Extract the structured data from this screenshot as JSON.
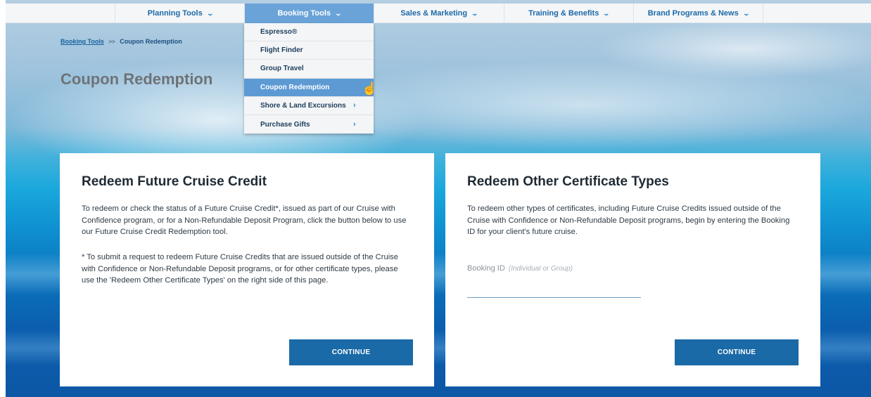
{
  "nav": {
    "items": [
      {
        "label": "Planning Tools",
        "chevron": "⌄"
      },
      {
        "label": "Booking Tools",
        "chevron": "⌄"
      },
      {
        "label": "Sales & Marketing",
        "chevron": "⌄"
      },
      {
        "label": "Training & Benefits",
        "chevron": "⌄"
      },
      {
        "label": "Brand Programs & News",
        "chevron": "⌄"
      }
    ],
    "active": "Booking Tools"
  },
  "dropdown": {
    "items": [
      {
        "label": "Espresso®"
      },
      {
        "label": "Flight Finder"
      },
      {
        "label": "Group Travel"
      },
      {
        "label": "Coupon Redemption"
      },
      {
        "label": "Shore & Land Excursions",
        "arrow": "›"
      },
      {
        "label": "Purchase Gifts",
        "arrow": "›"
      }
    ],
    "selected": "Coupon Redemption"
  },
  "breadcrumb": {
    "link": "Booking Tools",
    "separator": ">>",
    "current": "Coupon Redemption"
  },
  "page_title": "Coupon Redemption",
  "cards": {
    "future_credit": {
      "title": "Redeem Future Cruise Credit",
      "para1": "To redeem or check the status of a Future Cruise Credit*, issued as part of our Cruise with Confidence program, or for a Non-Refundable Deposit Program, click the button below to use our Future Cruise Credit Redemption tool.",
      "para2": "* To submit a request to redeem Future Cruise Credits that are issued outside of the Cruise with Confidence or Non-Refundable Deposit programs, or for other certificate types, please use the 'Redeem Other Certificate Types' on the right side of this page.",
      "button": "CONTINUE"
    },
    "other_certificates": {
      "title": "Redeem Other Certificate Types",
      "para1": "To redeem other types of certificates, including Future Cruise Credits issued outside of the Cruise with Confidence or Non-Refundable Deposit programs, begin by entering the Booking ID for your client's future cruise.",
      "field_label": "Booking ID",
      "field_hint": "(Individual or Group)",
      "field_value": "",
      "button": "CONTINUE"
    }
  },
  "colors": {
    "nav_active": "#6aa3d8",
    "button": "#1a6aa7",
    "link": "#16609e"
  }
}
